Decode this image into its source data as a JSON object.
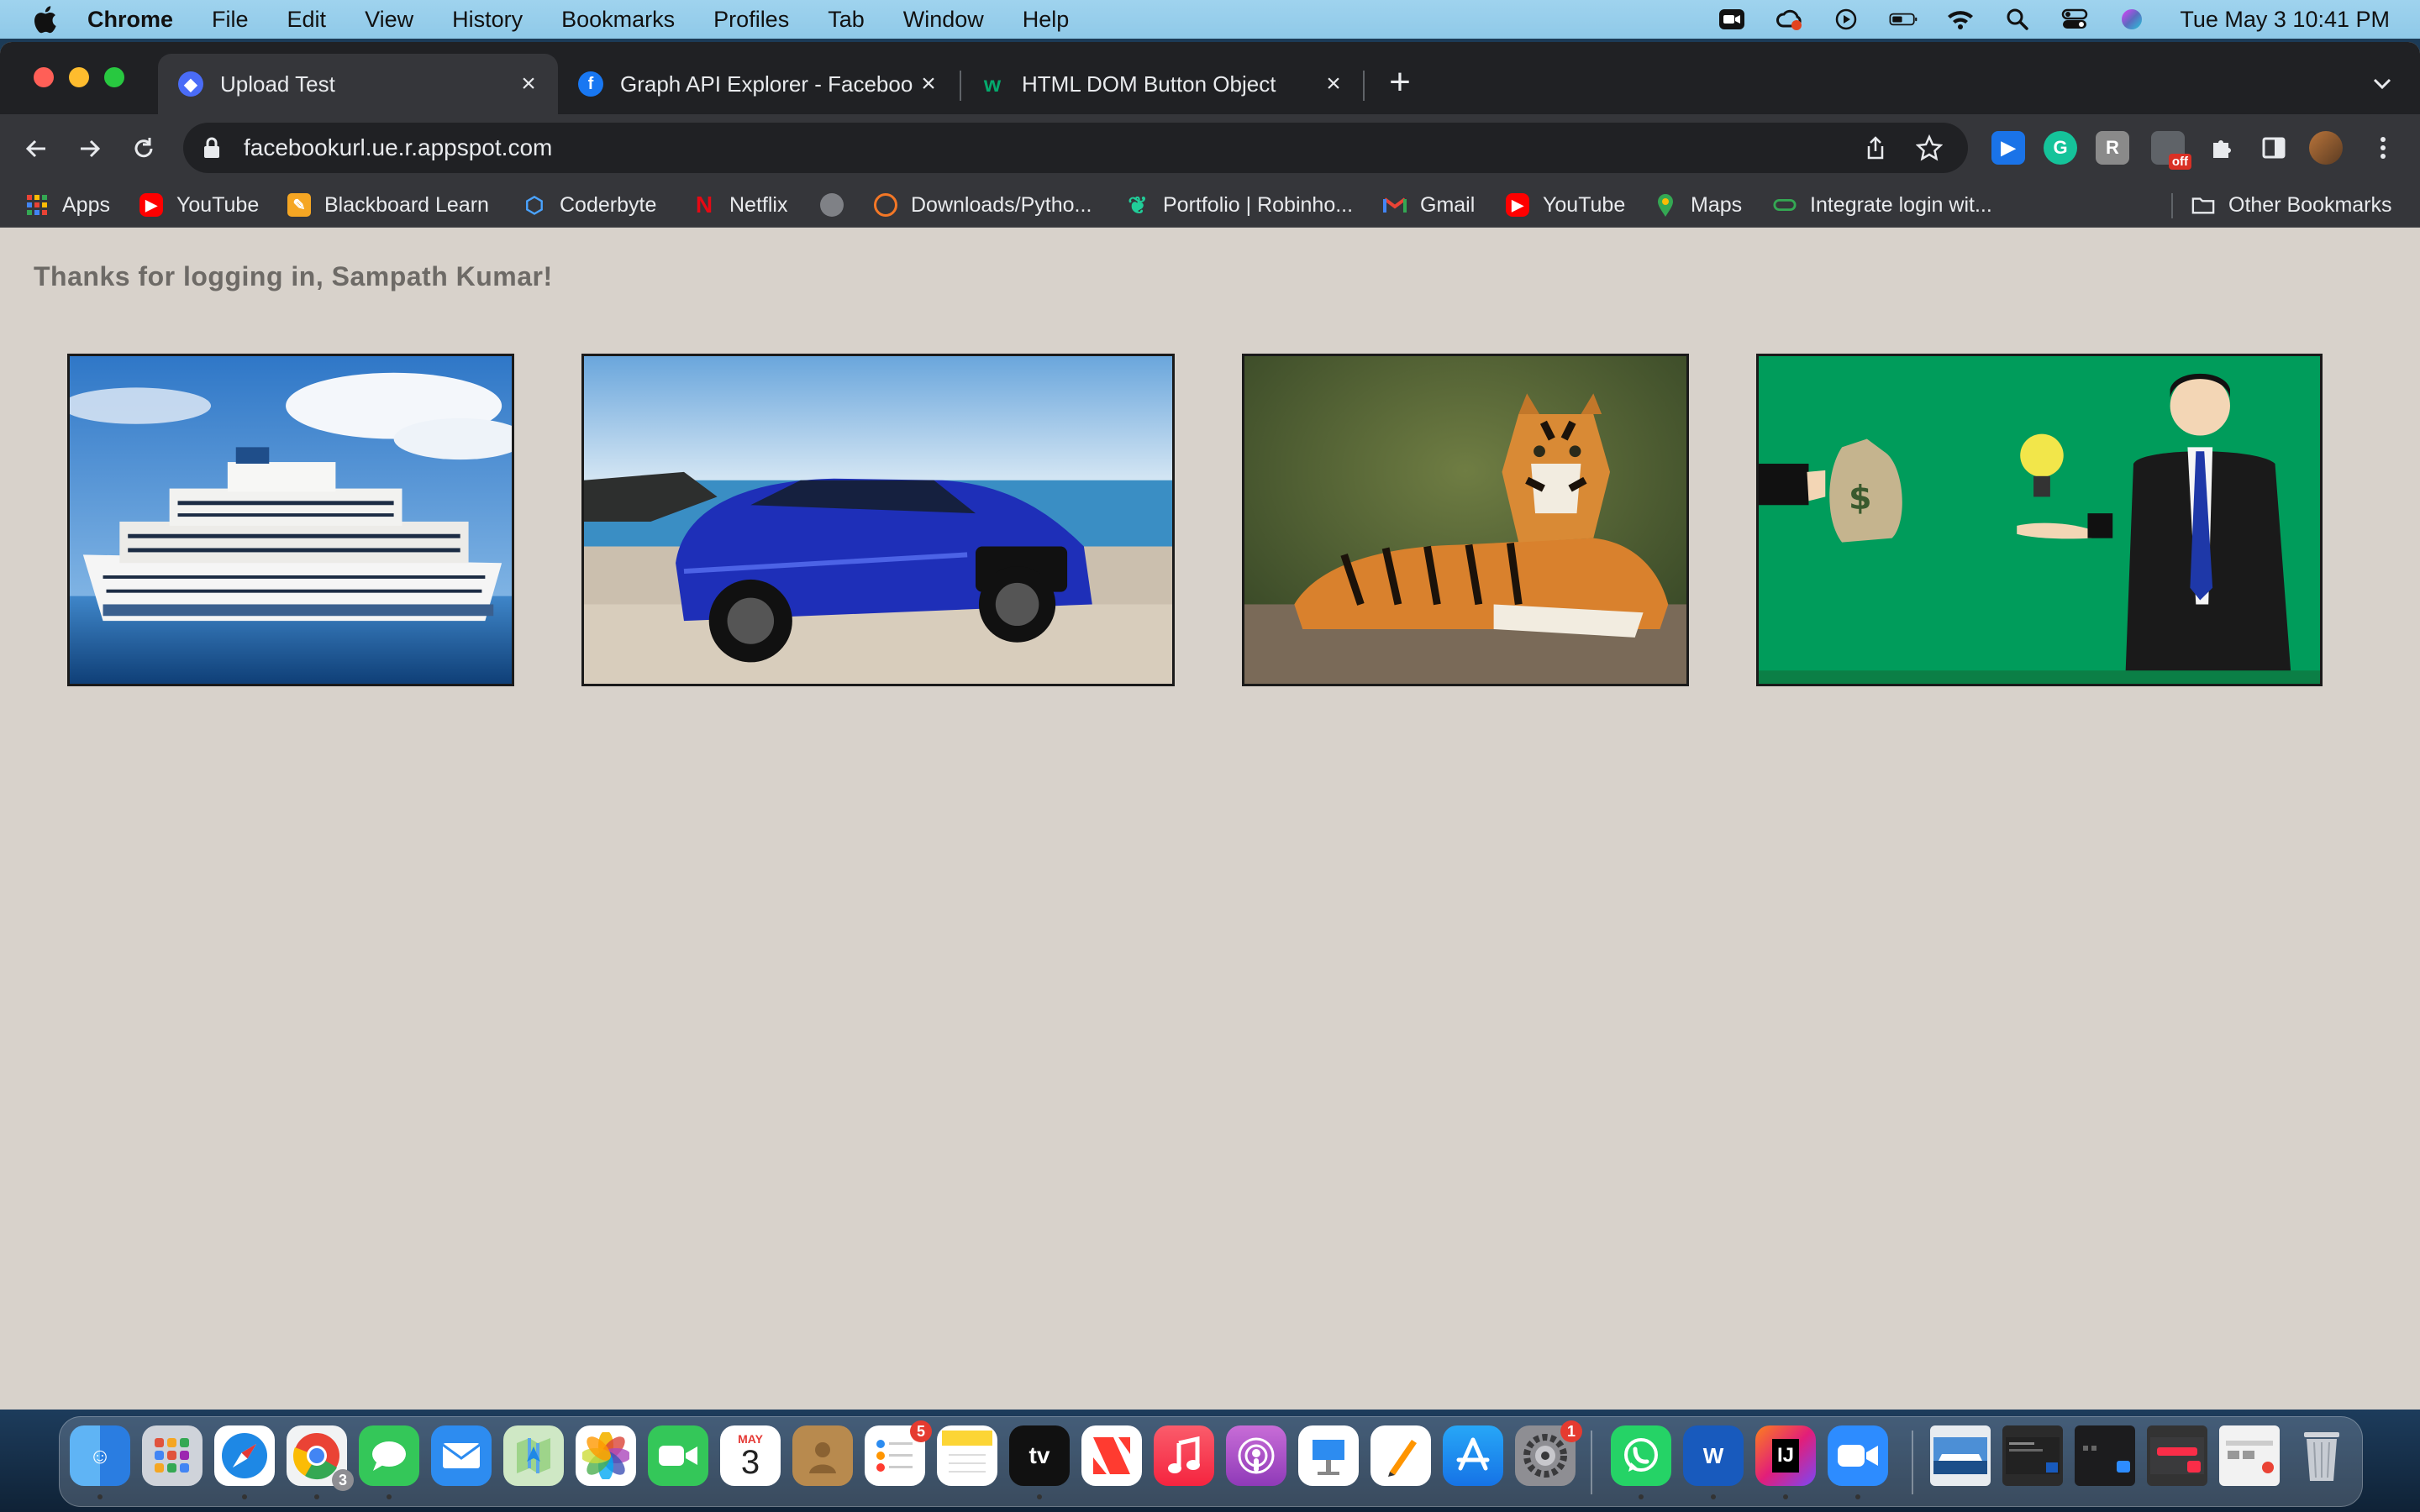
{
  "menubar": {
    "app_name": "Chrome",
    "items": [
      "File",
      "Edit",
      "View",
      "History",
      "Bookmarks",
      "Profiles",
      "Tab",
      "Window",
      "Help"
    ],
    "clock": "Tue May 3  10:41 PM"
  },
  "tabs": [
    {
      "title": "Upload Test",
      "active": true
    },
    {
      "title": "Graph API Explorer - Facebook",
      "active": false
    },
    {
      "title": "HTML DOM Button Object",
      "active": false
    }
  ],
  "omnibox": {
    "url": "facebookurl.ue.r.appspot.com"
  },
  "extensions": {
    "off_label": "off"
  },
  "bookmarks": [
    {
      "label": "Apps"
    },
    {
      "label": "YouTube"
    },
    {
      "label": "Blackboard Learn"
    },
    {
      "label": "Coderbyte"
    },
    {
      "label": "Netflix"
    },
    {
      "label": ""
    },
    {
      "label": "Downloads/Pytho..."
    },
    {
      "label": "Portfolio | Robinho..."
    },
    {
      "label": "Gmail"
    },
    {
      "label": "YouTube"
    },
    {
      "label": "Maps"
    },
    {
      "label": "Integrate login wit..."
    }
  ],
  "other_bookmarks": "Other Bookmarks",
  "page": {
    "greeting": "Thanks for logging in, Sampath Kumar!",
    "images": [
      {
        "subject": "cruise-ship"
      },
      {
        "subject": "blue-car"
      },
      {
        "subject": "tiger"
      },
      {
        "subject": "business-idea-illustration"
      }
    ]
  },
  "dock": {
    "calendar_month": "MAY",
    "calendar_day": "3",
    "chrome_badge": "3",
    "reminders_badge": "5",
    "settings_badge": "1",
    "tv_label": "tv",
    "word_label": "W",
    "intellij_label": "IJ"
  },
  "colors": {
    "page_bg": "#d8d2cb",
    "greeting": "#6d6a66",
    "chrome_dark": "#202124",
    "toolbar": "#35363a"
  }
}
